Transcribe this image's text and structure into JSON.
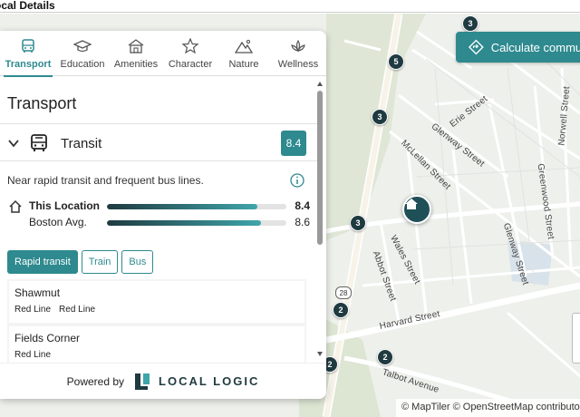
{
  "window": {
    "title": "ocal Details"
  },
  "map": {
    "calculate_button": "Calculate commute",
    "attribution": "© MapTiler © OpenStreetMap contributors",
    "route_shield": "28",
    "streets": [
      {
        "name": "Erie Street"
      },
      {
        "name": "Glenway Street"
      },
      {
        "name": "McLellan Street"
      },
      {
        "name": "Greenwood Street"
      },
      {
        "name": "Norwell Street"
      },
      {
        "name": "Glenway Street"
      },
      {
        "name": "Wales Street"
      },
      {
        "name": "Abbot Street"
      },
      {
        "name": "Harvard Street"
      },
      {
        "name": "Talbot Avenue"
      }
    ],
    "markers": [
      "3",
      "5",
      "3",
      "3",
      "2",
      "2",
      "2"
    ]
  },
  "panel": {
    "tabs": [
      {
        "label": "Transport",
        "icon": "bus-icon",
        "active": true
      },
      {
        "label": "Education",
        "icon": "graduation-cap-icon",
        "active": false
      },
      {
        "label": "Amenities",
        "icon": "storefront-icon",
        "active": false
      },
      {
        "label": "Character",
        "icon": "star-icon",
        "active": false
      },
      {
        "label": "Nature",
        "icon": "mountain-icon",
        "active": false
      },
      {
        "label": "Wellness",
        "icon": "lotus-icon",
        "active": false
      }
    ],
    "section_title": "Transport",
    "transit": {
      "label": "Transit",
      "score": "8.4",
      "description": "Near rapid transit and frequent bus lines.",
      "stats": [
        {
          "label": "This Location",
          "value": "8.4",
          "fraction": 0.84
        },
        {
          "label": "Boston Avg.",
          "value": "8.6",
          "fraction": 0.86
        }
      ],
      "filters": [
        {
          "label": "Rapid transit",
          "active": true
        },
        {
          "label": "Train",
          "active": false
        },
        {
          "label": "Bus",
          "active": false
        }
      ],
      "stops": [
        {
          "name": "Shawmut",
          "lines": [
            "Red Line",
            "Red Line"
          ]
        },
        {
          "name": "Fields Corner",
          "lines": [
            "Red Line"
          ]
        }
      ]
    },
    "powered_by": "Powered by",
    "brand": "LOCAL LOGIC"
  },
  "colors": {
    "accent": "#2e8a8f",
    "dark": "#1f3a40"
  }
}
